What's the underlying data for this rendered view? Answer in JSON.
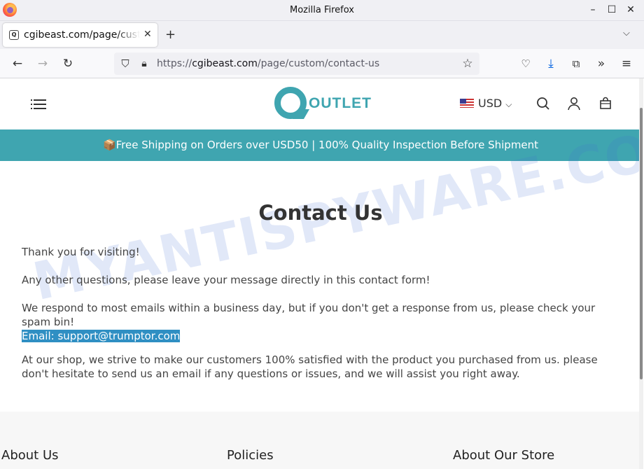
{
  "window": {
    "title": "Mozilla Firefox",
    "controls": [
      "–",
      "☐",
      "✕"
    ]
  },
  "tab": {
    "label": "cgibeast.com/page/custom/contact-us",
    "favicon": "Q"
  },
  "nav": {
    "url_scheme": "https://",
    "url_host": "cgibeast.com",
    "url_path": "/page/custom/contact-us"
  },
  "site": {
    "logo_text": "OUTLET",
    "currency": "USD",
    "announcement": "📦Free Shipping on Orders over USD50 | 100% Quality Inspection Before Shipment",
    "watermark": "MYANTISPYWARE.COM",
    "title": "Contact Us",
    "paragraphs": {
      "p1": "Thank you for visiting!",
      "p2": "Any other questions, please leave your message directly in this contact form!",
      "p3": "We respond to most emails within a business day, but if you don't get a response from us, please check your spam bin!",
      "email_label": "Email: ",
      "email_value": "support@trumptor.com",
      "p5": "At our shop, we strive to make our customers 100% satisfied with the product you purchased from us. please don't hesitate to send us an email if any questions or issues, and we will assist you right away."
    },
    "footer": {
      "col1": "About Us",
      "col2": "Policies",
      "col3": "About Our Store"
    }
  },
  "colors": {
    "brand": "#3fa5b0",
    "selection": "#2f8fc3"
  }
}
